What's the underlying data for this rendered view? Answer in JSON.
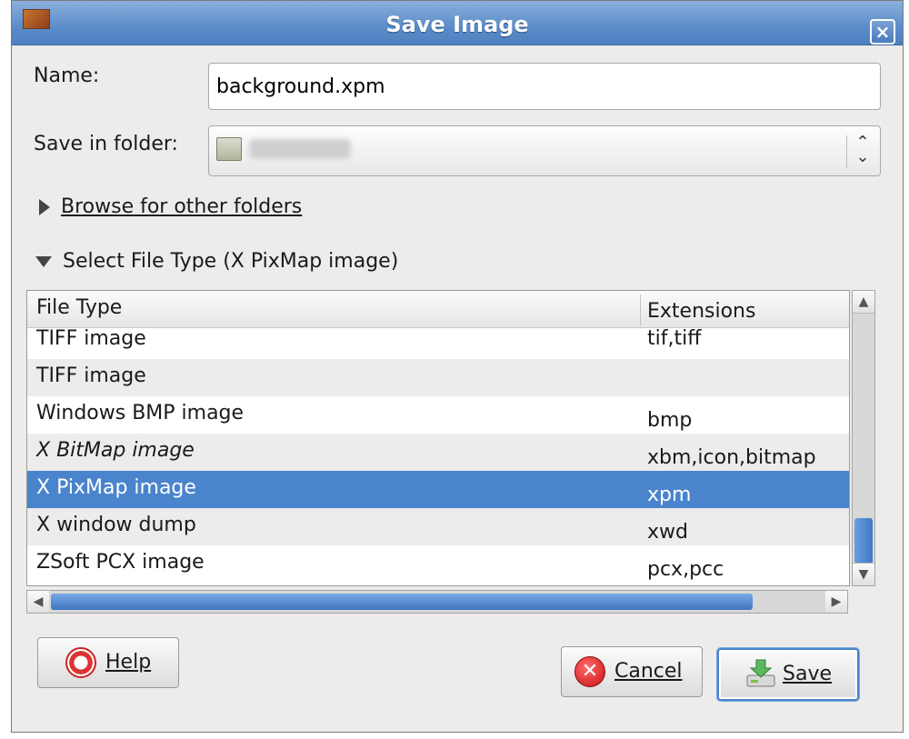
{
  "window": {
    "title": "Save Image",
    "close_glyph": "×"
  },
  "form": {
    "name_label": "Name:",
    "name_value": "background.xpm",
    "folder_label": "Save in folder:",
    "folder_arrows": "⌃⌄"
  },
  "browse": {
    "label": "Browse for other folders",
    "expanded": false
  },
  "file_type": {
    "label": "Select File Type (X PixMap image)",
    "expanded": true
  },
  "table": {
    "columns": [
      "File Type",
      "Extensions"
    ],
    "rows": [
      {
        "type": "TIFF image",
        "ext": "tif,tiff"
      },
      {
        "type": "TIFF image",
        "ext": ""
      },
      {
        "type": "Windows BMP image",
        "ext": "bmp"
      },
      {
        "type": "X BitMap image",
        "ext": "xbm,icon,bitmap"
      },
      {
        "type": "X PixMap image",
        "ext": "xpm",
        "selected": true
      },
      {
        "type": "X window dump",
        "ext": "xwd"
      },
      {
        "type": "ZSoft PCX image",
        "ext": "pcx,pcc"
      }
    ]
  },
  "buttons": {
    "help": "Help",
    "cancel": "Cancel",
    "save": "Save"
  },
  "colors": {
    "titlebar": "#5b8cc9",
    "selection": "#4a84cc",
    "dialog_bg": "#edeceb"
  }
}
